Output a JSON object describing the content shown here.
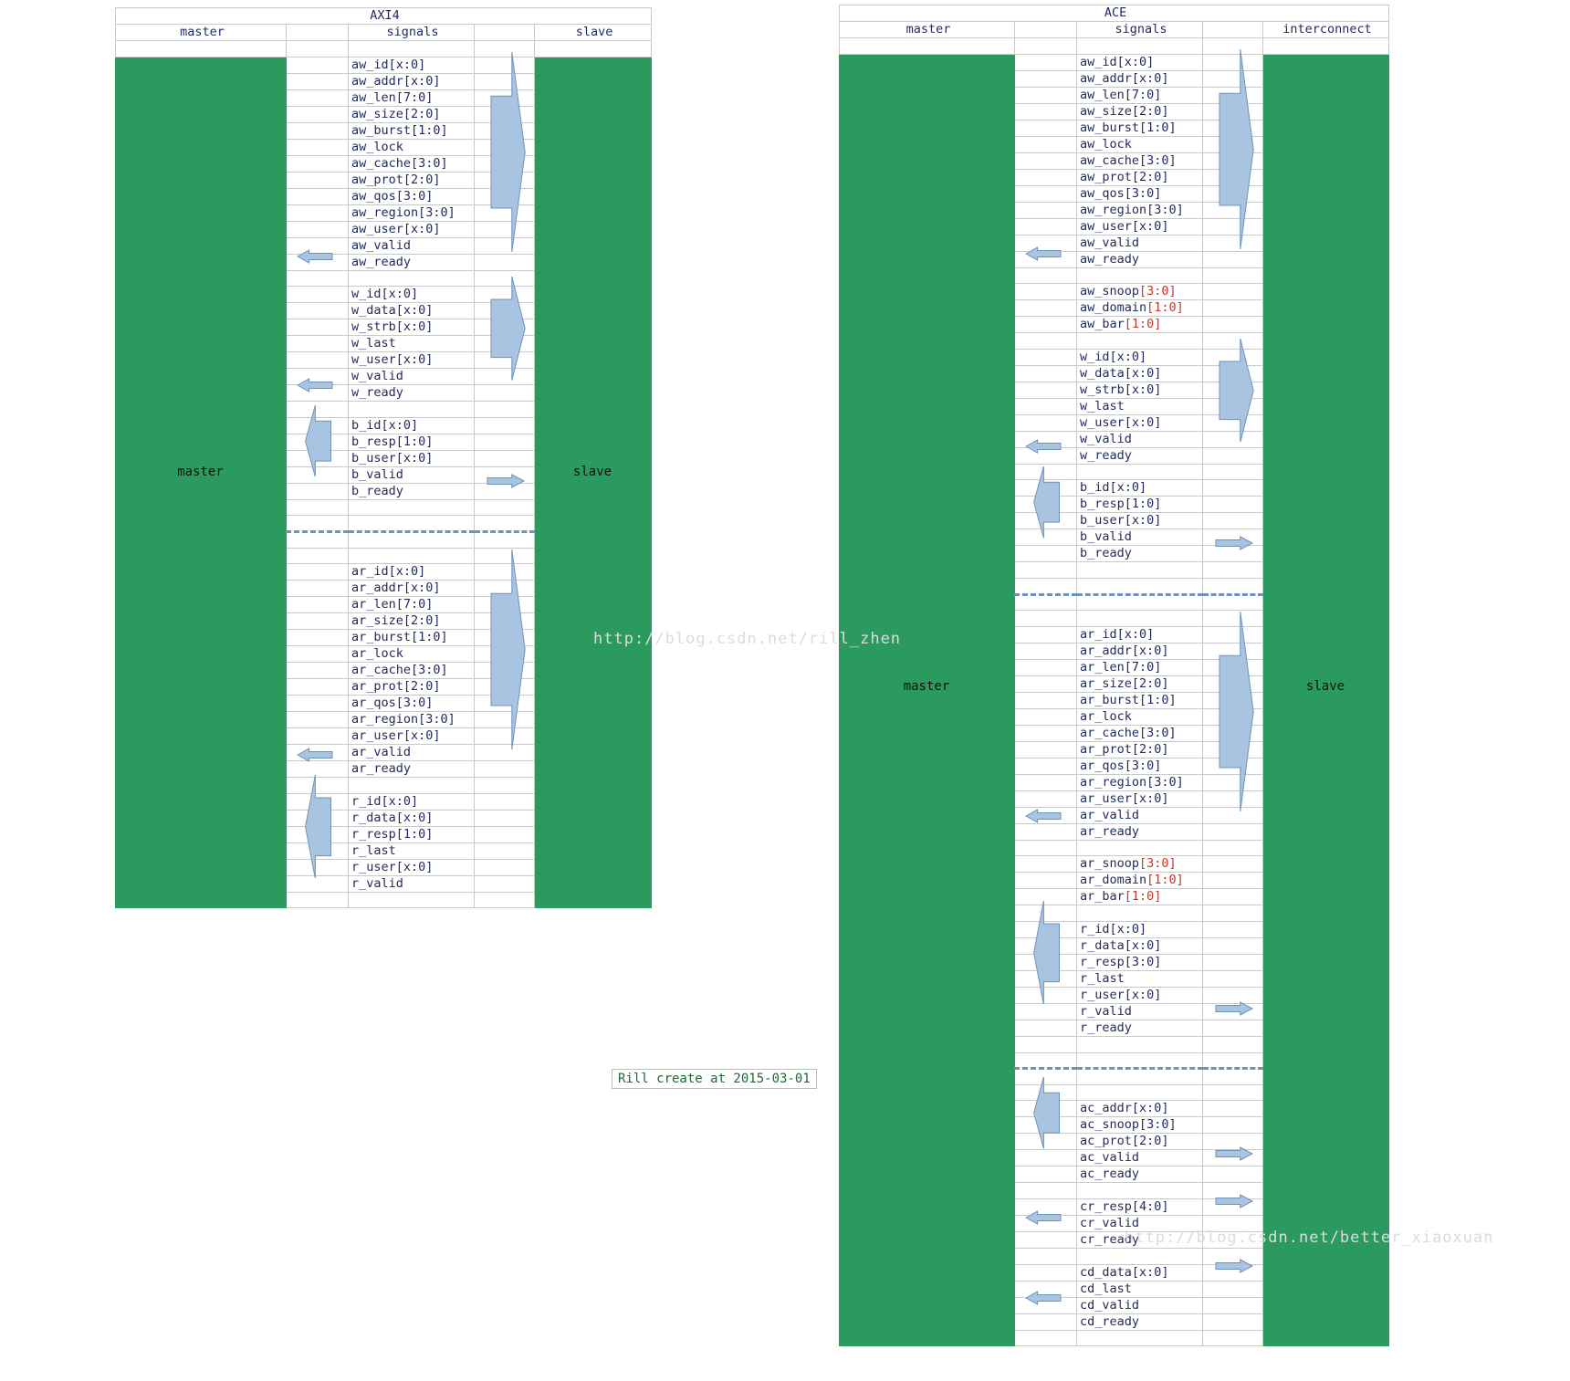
{
  "page": {
    "watermark_left": "http://blog.csdn.net/rill_zhen",
    "watermark_right": "http://blog.csdn.net/better_xiaoxuan",
    "note": "Rill create at 2015-03-01",
    "colors": {
      "block_green": "#2a9a5f",
      "header_red": "#c0392b",
      "title_blue": "#1f3a93",
      "signal_blue": "#1f2a5e",
      "snoop_magenta": "#d63bd6",
      "arrow_fill": "#a8c4e0",
      "arrow_stroke": "#6f93b8",
      "grid": "#c9c9c9",
      "note_green": "#1a6b37"
    }
  },
  "axi4": {
    "title": "AXI4",
    "headers": {
      "left": "master",
      "middle": "signals",
      "right": "slave"
    },
    "left_block_label": "master",
    "right_block_label": "slave",
    "groups": [
      {
        "name": "aw-channel",
        "signals": [
          "aw_id[x:0]",
          "aw_addr[x:0]",
          "aw_len[7:0]",
          "aw_size[2:0]",
          "aw_burst[1:0]",
          "aw_lock",
          "aw_cache[3:0]",
          "aw_prot[2:0]",
          "aw_qos[3:0]",
          "aw_region[3:0]",
          "aw_user[x:0]",
          "aw_valid",
          "aw_ready"
        ],
        "right_arrow": {
          "direction": "right",
          "from": 0,
          "to": 11
        },
        "left_arrow": {
          "direction": "left",
          "at": 12
        }
      },
      {
        "name": "w-channel",
        "signals": [
          "w_id[x:0]",
          "w_data[x:0]",
          "w_strb[x:0]",
          "w_last",
          "w_user[x:0]",
          "w_valid",
          "w_ready"
        ],
        "right_arrow": {
          "direction": "right",
          "from": 0,
          "to": 5
        },
        "left_arrow": {
          "direction": "left",
          "at": 6
        }
      },
      {
        "name": "b-channel",
        "signals": [
          "b_id[x:0]",
          "b_resp[1:0]",
          "b_user[x:0]",
          "b_valid",
          "b_ready"
        ],
        "left_arrow_block": {
          "direction": "left",
          "from": 0,
          "to": 3
        },
        "right_arrow_small": {
          "direction": "right",
          "at": 4
        }
      },
      {
        "name": "separator",
        "separator": true
      },
      {
        "name": "ar-channel",
        "signals": [
          "ar_id[x:0]",
          "ar_addr[x:0]",
          "ar_len[7:0]",
          "ar_size[2:0]",
          "ar_burst[1:0]",
          "ar_lock",
          "ar_cache[3:0]",
          "ar_prot[2:0]",
          "ar_qos[3:0]",
          "ar_region[3:0]",
          "ar_user[x:0]",
          "ar_valid",
          "ar_ready"
        ],
        "right_arrow": {
          "direction": "right",
          "from": 0,
          "to": 11
        },
        "left_arrow": {
          "direction": "left",
          "at": 12
        }
      },
      {
        "name": "r-channel",
        "signals": [
          "r_id[x:0]",
          "r_data[x:0]",
          "r_resp[1:0]",
          "r_last",
          "r_user[x:0]",
          "r_valid"
        ],
        "left_arrow_block": {
          "direction": "left",
          "from": 0,
          "to": 5
        }
      }
    ]
  },
  "ace": {
    "title": "ACE",
    "headers": {
      "left": "master",
      "middle": "signals",
      "right": "interconnect"
    },
    "left_block_label": "master",
    "right_block_label": "slave",
    "groups": [
      {
        "name": "aw-channel",
        "signals": [
          "aw_id[x:0]",
          "aw_addr[x:0]",
          "aw_len[7:0]",
          "aw_size[2:0]",
          "aw_burst[1:0]",
          "aw_lock",
          "aw_cache[3:0]",
          "aw_prot[2:0]",
          "aw_qos[3:0]",
          "aw_region[3:0]",
          "aw_user[x:0]",
          "aw_valid",
          "aw_ready"
        ],
        "right_arrow": {
          "direction": "right",
          "from": 0,
          "to": 11
        },
        "left_arrow": {
          "direction": "left",
          "at": 12
        }
      },
      {
        "name": "aw-snoop-channel",
        "snoop": true,
        "signals": [
          "aw_snoop[3:0]",
          "aw_domain[1:0]",
          "aw_bar[1:0]"
        ]
      },
      {
        "name": "w-channel",
        "signals": [
          "w_id[x:0]",
          "w_data[x:0]",
          "w_strb[x:0]",
          "w_last",
          "w_user[x:0]",
          "w_valid",
          "w_ready"
        ],
        "right_arrow": {
          "direction": "right",
          "from": 0,
          "to": 5
        },
        "left_arrow": {
          "direction": "left",
          "at": 6
        }
      },
      {
        "name": "b-channel",
        "signals": [
          "b_id[x:0]",
          "b_resp[1:0]",
          "b_user[x:0]",
          "b_valid",
          "b_ready"
        ],
        "left_arrow_block": {
          "direction": "left",
          "from": 0,
          "to": 3
        },
        "right_arrow_small": {
          "direction": "right",
          "at": 4
        }
      },
      {
        "name": "separator",
        "separator": true
      },
      {
        "name": "ar-channel",
        "signals": [
          "ar_id[x:0]",
          "ar_addr[x:0]",
          "ar_len[7:0]",
          "ar_size[2:0]",
          "ar_burst[1:0]",
          "ar_lock",
          "ar_cache[3:0]",
          "ar_prot[2:0]",
          "ar_qos[3:0]",
          "ar_region[3:0]",
          "ar_user[x:0]",
          "ar_valid",
          "ar_ready"
        ],
        "right_arrow": {
          "direction": "right",
          "from": 0,
          "to": 11
        },
        "left_arrow": {
          "direction": "left",
          "at": 12
        }
      },
      {
        "name": "ar-snoop-channel",
        "snoop": true,
        "signals": [
          "ar_snoop[3:0]",
          "ar_domain[1:0]",
          "ar_bar[1:0]"
        ]
      },
      {
        "name": "r-channel",
        "signals": [
          "r_id[x:0]",
          "r_data[x:0]",
          "r_resp[3:0]",
          "r_last",
          "r_user[x:0]",
          "r_valid",
          "r_ready"
        ],
        "left_arrow_block": {
          "direction": "left",
          "from": 0,
          "to": 5
        },
        "right_arrow_small": {
          "direction": "right",
          "at": 6
        }
      },
      {
        "name": "separator",
        "separator": true
      },
      {
        "name": "ac-channel",
        "signals": [
          "ac_addr[x:0]",
          "ac_snoop[3:0]",
          "ac_prot[2:0]",
          "ac_valid",
          "ac_ready"
        ],
        "left_arrow_block": {
          "direction": "left",
          "from": 0,
          "to": 3
        },
        "right_arrow_small": {
          "direction": "right",
          "at": 4
        }
      },
      {
        "name": "cr-channel",
        "signals": [
          "cr_resp[4:0]",
          "cr_valid",
          "cr_ready"
        ],
        "right_arrow_small": {
          "direction": "right",
          "at": 1
        },
        "left_arrow": {
          "direction": "left",
          "at": 2
        }
      },
      {
        "name": "cd-channel",
        "signals": [
          "cd_data[x:0]",
          "cd_last",
          "cd_valid",
          "cd_ready"
        ],
        "right_arrow_small": {
          "direction": "right",
          "at": 1
        },
        "left_arrow": {
          "direction": "left",
          "at": 3
        }
      }
    ]
  }
}
